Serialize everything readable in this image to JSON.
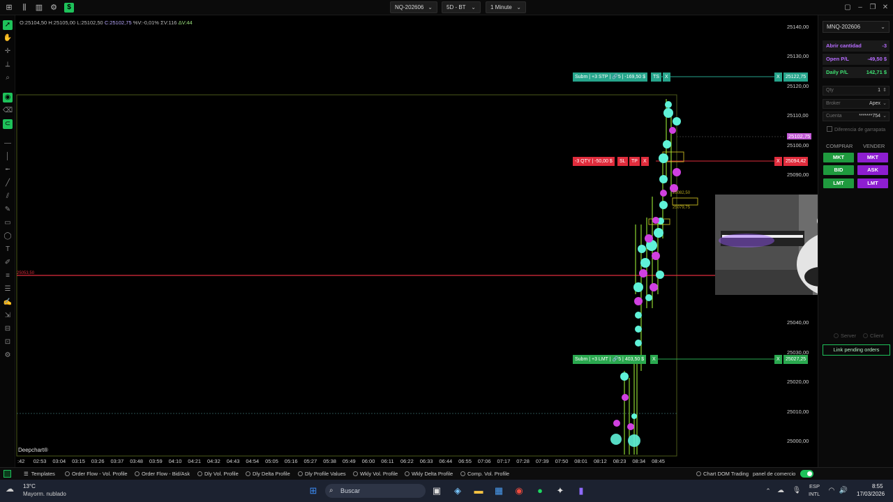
{
  "topbar": {
    "symbol": "NQ-202606",
    "range": "5D - BT",
    "interval": "1 Minute"
  },
  "ohlc": {
    "open": "O:25104,50",
    "high": "H:25105,00",
    "low": "L:25102,50",
    "close": "C:25102,75",
    "pctv": "%V:-0,01%",
    "sigma_v": "ΣV:116",
    "delta_v": "ΔV:44"
  },
  "price_axis": [
    "25140,00",
    "25130,00",
    "25120,00",
    "25110,00",
    "25100,00",
    "25090,00",
    "25040,00",
    "25030,00",
    "25020,00",
    "25010,00",
    "25000,00"
  ],
  "time_axis": [
    ":42",
    "02:53",
    "03:04",
    "03:15",
    "03:26",
    "03:37",
    "03:48",
    "03:59",
    "04:10",
    "04:21",
    "04:32",
    "04:43",
    "04:54",
    "05:05",
    "05:16",
    "05:27",
    "05:38",
    "05:49",
    "06:00",
    "06:11",
    "06:22",
    "06:33",
    "06:44",
    "06:55",
    "07:06",
    "07:17",
    "07:28",
    "07:39",
    "07:50",
    "08:01",
    "08:12",
    "08:23",
    "08:34",
    "08:45"
  ],
  "watermark": "Deepchart®",
  "orders": {
    "stop_label": "Subm | +3 STP | 🔗5 | -169,50 $",
    "stop_ts": "TS",
    "stop_x": "X",
    "stop_price": "25122,75",
    "pos_label": "-3 QTY | -50,00 $",
    "pos_sl": "SL",
    "pos_tp": "TP",
    "pos_x": "X",
    "pos_price": "25094,42",
    "pos_x_right": "X",
    "limit_label": "Subm | +3 LMT | 🔗5 | 403,50 $",
    "limit_x": "X",
    "limit_price": "25027,25",
    "limit_x_right": "X",
    "stop_x_right": "X",
    "last_price": "25102,75",
    "level_label": "25053,50",
    "small_labels": [
      "25082,50",
      "25079,75"
    ]
  },
  "panel": {
    "account_symbol": "MNQ-202606",
    "abrir_label": "Abrir cantidad",
    "abrir_value": "-3",
    "openpl_label": "Open P/L",
    "openpl_value": "-49,50 $",
    "dailypl_label": "Daily P/L",
    "dailypl_value": "142,71 $",
    "qty_label": "Qty",
    "qty_value": "1",
    "broker_label": "Broker",
    "broker_value": "Apex",
    "cuenta_label": "Cuenta",
    "cuenta_value": "*******754",
    "diff_label": "Diferencia de garrapata",
    "buy_header": "COMPRAR",
    "sell_header": "VENDER",
    "buy_buttons": [
      "MKT",
      "BID",
      "LMT"
    ],
    "sell_buttons": [
      "MKT",
      "ASK",
      "LMT"
    ],
    "server_label": "Server",
    "client_label": "Client",
    "link_label": "Link pending orders"
  },
  "bottombar": {
    "templates": "Templates",
    "items": [
      "Order Flow - Vol. Profile",
      "Order Flow - Bid/Ask",
      "Dly Vol. Profile",
      "Dly Delta Profile",
      "Dly Profile Values",
      "Wkly Vol. Profile",
      "Wkly Delta Profile",
      "Comp. Vol. Profile"
    ],
    "dom_label": "Chart DOM Trading",
    "panel_label": "panel de comercio"
  },
  "taskbar": {
    "weather_temp": "13°C",
    "weather_desc": "Mayorm. nublado",
    "search_placeholder": "Buscar",
    "lang1": "ESP",
    "lang2": "INTL",
    "time": "8:55",
    "date": "17/03/2026"
  },
  "colors": {
    "accent_green": "#1ec25a",
    "buy_green": "#1f9a3e",
    "sell_purple": "#8d1ed0",
    "level_red": "#e02c3c",
    "order_teal": "#26a58c"
  }
}
